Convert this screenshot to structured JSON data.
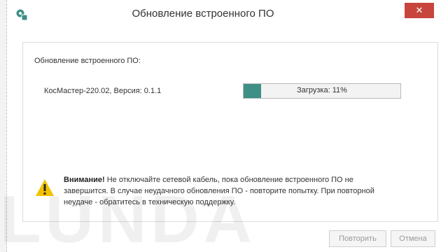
{
  "window": {
    "title": "Обновление встроенного ПО",
    "close_label": "✕"
  },
  "content": {
    "heading": "Обновление встроенного ПО:",
    "device": "КосМастер-220.02, Версия: 0.1.1",
    "progress": {
      "label": "Загрузка: 11%",
      "percent": 11
    },
    "warning": {
      "prefix": "Внимание!",
      "text": "Не отключайте сетевой кабель, пока обновление встроенного ПО не завершится. В случае неудачного обновления ПО - повторите попытку. При повторной неудаче - обратитесь в техническую поддержку."
    }
  },
  "buttons": {
    "retry": "Повторить",
    "cancel": "Отмена"
  },
  "watermark": "LUNDA",
  "colors": {
    "accent": "#3e8f86",
    "close": "#c7453c",
    "warning": "#f2c200"
  },
  "icons": {
    "app": "app-gear-icon",
    "warning": "warning-triangle-icon"
  }
}
